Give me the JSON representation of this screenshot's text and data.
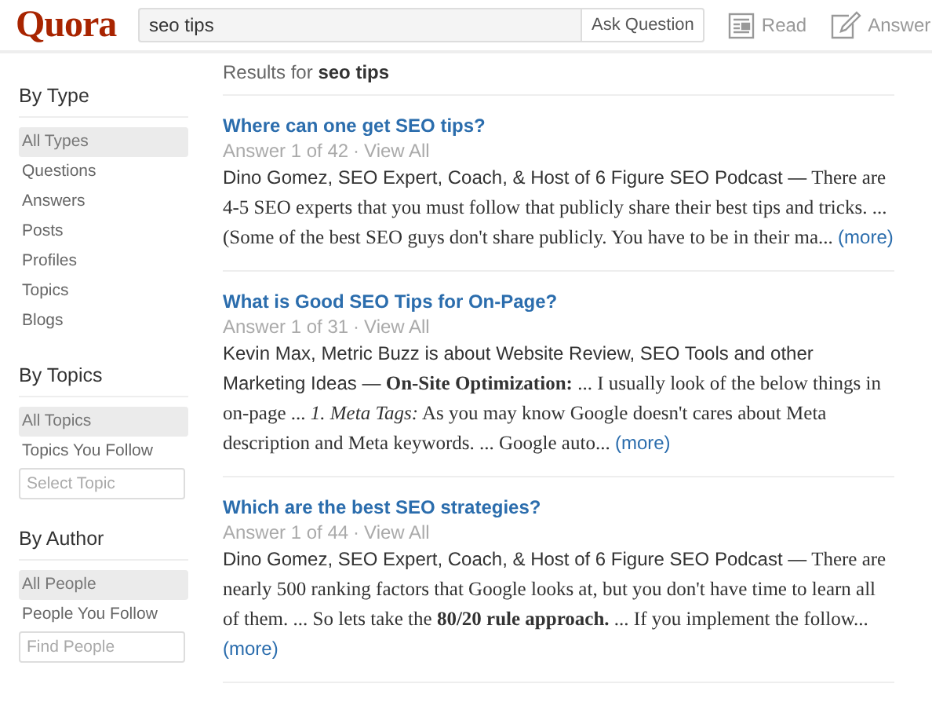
{
  "header": {
    "logo": "Quora",
    "search": {
      "value": "seo tips"
    },
    "ask_button": "Ask Question",
    "nav": [
      {
        "kind": "read",
        "label": "Read"
      },
      {
        "kind": "answer",
        "label": "Answer"
      }
    ]
  },
  "sidebar": {
    "sections": [
      {
        "title": "By Type",
        "items": [
          {
            "label": "All Types",
            "selected": true
          },
          {
            "label": "Questions",
            "selected": false
          },
          {
            "label": "Answers",
            "selected": false
          },
          {
            "label": "Posts",
            "selected": false
          },
          {
            "label": "Profiles",
            "selected": false
          },
          {
            "label": "Topics",
            "selected": false
          },
          {
            "label": "Blogs",
            "selected": false
          }
        ]
      },
      {
        "title": "By Topics",
        "items": [
          {
            "label": "All Topics",
            "selected": true
          },
          {
            "label": "Topics You Follow",
            "selected": false
          }
        ],
        "field": {
          "placeholder": "Select Topic"
        }
      },
      {
        "title": "By Author",
        "items": [
          {
            "label": "All People",
            "selected": true
          },
          {
            "label": "People You Follow",
            "selected": false
          }
        ],
        "field": {
          "placeholder": "Find People"
        }
      }
    ]
  },
  "results": {
    "prefix": "Results for",
    "query": "seo tips",
    "items": [
      {
        "question": "Where can one get SEO tips?",
        "answer_count": "Answer 1 of 42",
        "separator": "·",
        "view_all": "View All",
        "author": "Dino Gomez, SEO Expert, Coach, & Host of 6 Figure SEO Podcast —",
        "excerpt": "There are 4-5 SEO experts that you must follow that publicly share their best tips and tricks.  ... (Some of the best SEO guys don't share publicly. You have to be in their ma...",
        "more": "(more)"
      },
      {
        "question": "What is Good SEO Tips for On-Page?",
        "answer_count": "Answer 1 of 31",
        "separator": "·",
        "view_all": "View All",
        "author": "Kevin Max, Metric Buzz is about Website Review, SEO Tools and other Marketing Ideas —",
        "excerpt": "**On-Site Optimization:** ... I usually look of the below things in on-page ... *1. Meta Tags:* As you may know Google doesn't cares about Meta description and Meta keywords. ... Google auto...",
        "more": "(more)"
      },
      {
        "question": "Which are the best SEO strategies?",
        "answer_count": "Answer 1 of 44",
        "separator": "·",
        "view_all": "View All",
        "author": "Dino Gomez, SEO Expert, Coach, & Host of 6 Figure SEO Podcast —",
        "excerpt": "There are nearly 500 ranking factors that Google looks at, but you don't have time to learn all of them. ... So lets take the **80/20 rule approach.** ... If you implement the follow...",
        "more": "(more)"
      }
    ]
  }
}
